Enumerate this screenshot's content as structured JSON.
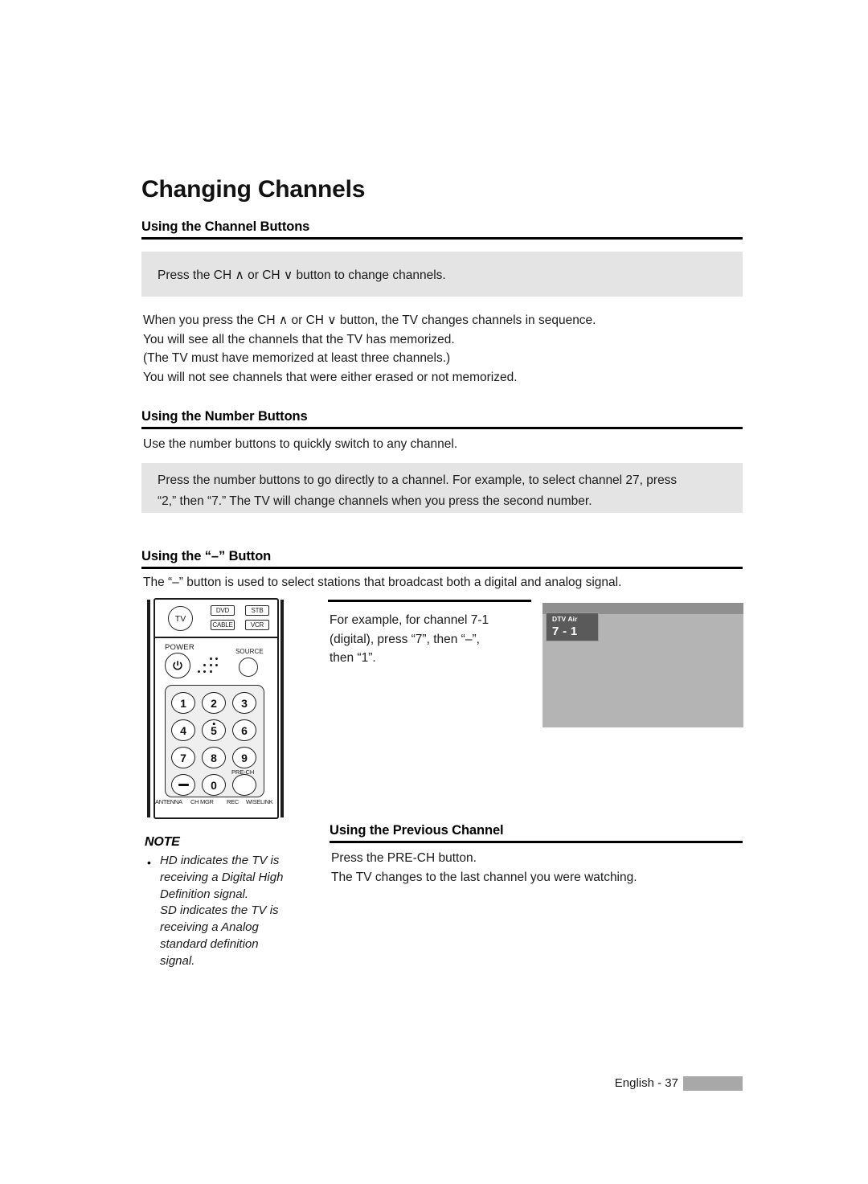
{
  "page": {
    "title": "Changing Channels",
    "footer_label": "English - 37"
  },
  "sections": {
    "channel_buttons": {
      "heading": "Using the Channel Buttons",
      "callout": "Press the CH  ∧  or CH  ∨  button to change channels.",
      "body": "When you press the CH  ∧  or CH  ∨  button, the TV changes channels in sequence.\nYou will see all the channels that the TV has memorized.\n(The TV must have memorized at least three channels.)\nYou will not see channels that were either erased or not memorized."
    },
    "number_buttons": {
      "heading": "Using the Number Buttons",
      "intro": "Use the number buttons to quickly switch to any channel.",
      "callout": "Press the number buttons to go directly to a channel. For example, to select channel 27, press\n“2,” then “7.” The TV will change channels when you press the second number."
    },
    "dash_button": {
      "heading": "Using the “–” Button",
      "intro": "The “–” button is used to select stations that broadcast both a digital and analog signal.",
      "example": "For example, for channel 7-1\n(digital), press “7”, then “–”,\nthen “1”."
    },
    "previous_channel": {
      "heading": "Using the Previous Channel",
      "body": "Press the PRE-CH button.\nThe TV changes to the last channel you were watching."
    }
  },
  "note": {
    "label": "NOTE",
    "bullet": "•",
    "text": "HD indicates the TV is\nreceiving a Digital High\nDefinition signal.\nSD indicates the TV is\nreceiving a Analog\nstandard definition\nsignal."
  },
  "tv_screen": {
    "osd_source": "DTV Air",
    "osd_channel": "7 - 1"
  },
  "remote": {
    "device_buttons": [
      {
        "label": "TV"
      },
      {
        "label": "DVD"
      },
      {
        "label": "STB"
      },
      {
        "label": "CABLE"
      },
      {
        "label": "VCR"
      }
    ],
    "power_label": "POWER",
    "source_label": "SOURCE",
    "prech_label": "PRE-CH",
    "keys": [
      {
        "label": "1"
      },
      {
        "label": "2"
      },
      {
        "label": "3"
      },
      {
        "label": "4"
      },
      {
        "label": "5"
      },
      {
        "label": "6"
      },
      {
        "label": "7"
      },
      {
        "label": "8"
      },
      {
        "label": "9"
      },
      {
        "label": "–"
      },
      {
        "label": "0"
      },
      {
        "label": ""
      }
    ],
    "bottom_labels": {
      "antenna": "ANTENNA",
      "ch_mgr": "CH MGR",
      "rec": "REC",
      "wiselink": "WISELINK"
    }
  },
  "colors": {
    "callout_bg": "#e4e4e4",
    "tv_screen_bg": "#b4b4b4",
    "tv_topband": "#8f8f8f",
    "osd_badge_bg": "#5a5a5a",
    "footer_bar": "#a8a8a8"
  }
}
